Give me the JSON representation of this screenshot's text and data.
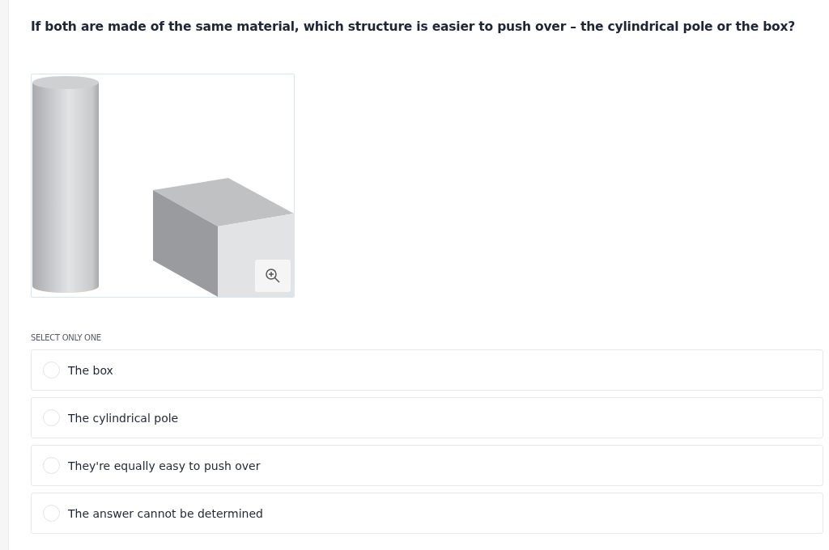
{
  "question": {
    "text": "If both are made of the same material, which structure is easier to push over – the cylindrical pole or the box?"
  },
  "instruction": "SELECT ONLY ONE",
  "choices": [
    {
      "label": "The box",
      "selected": false
    },
    {
      "label": "The cylindrical pole",
      "selected": false
    },
    {
      "label": "They're equally easy to push over",
      "selected": false
    },
    {
      "label": "The answer cannot be determined",
      "selected": false
    }
  ]
}
